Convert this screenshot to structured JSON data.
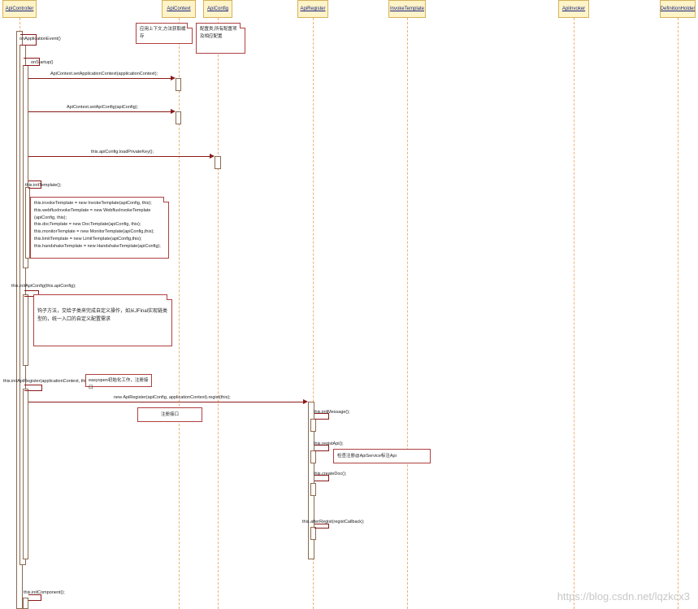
{
  "lifelines": [
    {
      "id": "ll-apicontroller",
      "name": "ApiController"
    },
    {
      "id": "ll-apicontext",
      "name": "ApiContext"
    },
    {
      "id": "ll-apiconfig",
      "name": "ApiConfig"
    },
    {
      "id": "ll-apiregister",
      "name": "ApiRegister"
    },
    {
      "id": "ll-invoketemplate",
      "name": "InvokeTemplate"
    },
    {
      "id": "ll-apiinvoker",
      "name": "ApiInvoker"
    },
    {
      "id": "ll-definitionholder",
      "name": "DefinitionHolder"
    }
  ],
  "messages": {
    "on_application_event": "onApplicationEvent()",
    "on_startup": "onStartup()",
    "set_application_context": "ApiContext.setApplicationContext(applicationContext);",
    "set_api_config": "ApiContext.setApiConfig(apiConfig);",
    "load_private_key": "this.apiConfig.loadPrivateKey();",
    "init_template": "this.initTemplate();",
    "init_api_config": "this.initApiConfig(this.apiConfig);",
    "init_api_register": "this.initApiRegister(applicationContext, this.apiConfig);",
    "new_api_register": "new ApiRegister(apiConfig, applicationContext).regist(this);",
    "init_message": "this.initMessage();",
    "regist_api": "this.registApi();",
    "create_doc": "this.createDoc();",
    "after_regist": "this.afterRegist(registCallback);",
    "init_component": "this.initComponent();"
  },
  "notes": {
    "apicontext_note": "应用上下文,方法获取缓存",
    "apiconfig_note": "配置类,所有配置项及相应配置",
    "template_lines": [
      "this.invokeTemplate = new InvokeTemplate(apiConfig, this);",
      "this.webfluxInvokeTemplate = new WebfluxInvokeTemplate",
      "(apiConfig, this);",
      "this.docTemplate = new DocTemplate(apiConfig, this);",
      "this.monitorTemplate = new MonitorTemplate(apiConfig,this);",
      "this.limitTemplate = new LimitTemplate(apiConfig,this);",
      "this.handshakeTemplate = new HandshakeTemplate(apiConfig);"
    ],
    "hook_note_lines": [
      "钩子方法，交给子类来完成自定义操作，如从JFinal实现链类",
      "型的，统一入口的自定义配置需求"
    ],
    "easyopen_note": "easyopen初始化工作，注册接口",
    "register_note": "注册接口",
    "regist_api_note": "检查注册@ApiService标注Api"
  },
  "watermark": "https://blog.csdn.net/lqzkcx3"
}
